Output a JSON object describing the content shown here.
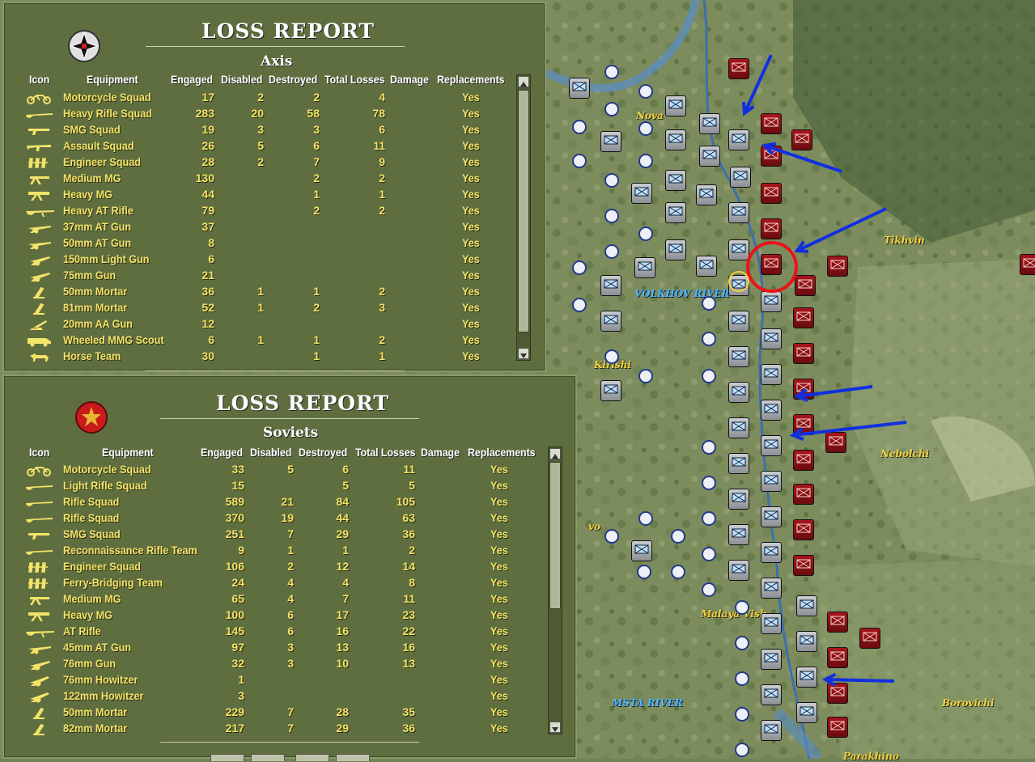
{
  "axis_report": {
    "title": "LOSS REPORT",
    "side": "Axis",
    "columns": [
      "Icon",
      "Equipment",
      "Engaged",
      "Disabled",
      "Destroyed",
      "Total Losses",
      "Damage",
      "Replacements"
    ],
    "rows": [
      {
        "icon": "motorcycle-icon",
        "equipment": "Motorcycle Squad",
        "engaged": "17",
        "disabled": "2",
        "destroyed": "2",
        "total": "4",
        "damage": "",
        "replacements": "Yes"
      },
      {
        "icon": "rifle-icon",
        "equipment": "Heavy Rifle Squad",
        "engaged": "283",
        "disabled": "20",
        "destroyed": "58",
        "total": "78",
        "damage": "",
        "replacements": "Yes"
      },
      {
        "icon": "smg-icon",
        "equipment": "SMG Squad",
        "engaged": "19",
        "disabled": "3",
        "destroyed": "3",
        "total": "6",
        "damage": "",
        "replacements": "Yes"
      },
      {
        "icon": "assault-rifle-icon",
        "equipment": "Assault Squad",
        "engaged": "26",
        "disabled": "5",
        "destroyed": "6",
        "total": "11",
        "damage": "",
        "replacements": "Yes"
      },
      {
        "icon": "engineer-icon",
        "equipment": "Engineer Squad",
        "engaged": "28",
        "disabled": "2",
        "destroyed": "7",
        "total": "9",
        "damage": "",
        "replacements": "Yes"
      },
      {
        "icon": "machine-gun-icon",
        "equipment": "Medium MG",
        "engaged": "130",
        "disabled": "",
        "destroyed": "2",
        "total": "2",
        "damage": "",
        "replacements": "Yes"
      },
      {
        "icon": "heavy-machine-gun-icon",
        "equipment": "Heavy MG",
        "engaged": "44",
        "disabled": "",
        "destroyed": "1",
        "total": "1",
        "damage": "",
        "replacements": "Yes"
      },
      {
        "icon": "at-rifle-icon",
        "equipment": "Heavy AT Rifle",
        "engaged": "79",
        "disabled": "",
        "destroyed": "2",
        "total": "2",
        "damage": "",
        "replacements": "Yes"
      },
      {
        "icon": "at-gun-icon",
        "equipment": "37mm AT Gun",
        "engaged": "37",
        "disabled": "",
        "destroyed": "",
        "total": "",
        "damage": "",
        "replacements": "Yes"
      },
      {
        "icon": "at-gun-icon",
        "equipment": "50mm AT Gun",
        "engaged": "8",
        "disabled": "",
        "destroyed": "",
        "total": "",
        "damage": "",
        "replacements": "Yes"
      },
      {
        "icon": "field-gun-icon",
        "equipment": "150mm Light Gun",
        "engaged": "6",
        "disabled": "",
        "destroyed": "",
        "total": "",
        "damage": "",
        "replacements": "Yes"
      },
      {
        "icon": "field-gun-icon",
        "equipment": "75mm Gun",
        "engaged": "21",
        "disabled": "",
        "destroyed": "",
        "total": "",
        "damage": "",
        "replacements": "Yes"
      },
      {
        "icon": "mortar-icon",
        "equipment": "50mm Mortar",
        "engaged": "36",
        "disabled": "1",
        "destroyed": "1",
        "total": "2",
        "damage": "",
        "replacements": "Yes"
      },
      {
        "icon": "mortar-icon",
        "equipment": "81mm Mortar",
        "engaged": "52",
        "disabled": "1",
        "destroyed": "2",
        "total": "3",
        "damage": "",
        "replacements": "Yes"
      },
      {
        "icon": "aa-gun-icon",
        "equipment": "20mm AA Gun",
        "engaged": "12",
        "disabled": "",
        "destroyed": "",
        "total": "",
        "damage": "",
        "replacements": "Yes"
      },
      {
        "icon": "armored-car-icon",
        "equipment": "Wheeled MMG Scout",
        "engaged": "6",
        "disabled": "1",
        "destroyed": "1",
        "total": "2",
        "damage": "",
        "replacements": "Yes"
      },
      {
        "icon": "horse-icon",
        "equipment": "Horse Team",
        "engaged": "30",
        "disabled": "",
        "destroyed": "1",
        "total": "1",
        "damage": "",
        "replacements": "Yes"
      }
    ],
    "scroll_position": 0.0
  },
  "soviet_report": {
    "title": "LOSS REPORT",
    "side": "Soviets",
    "columns": [
      "Icon",
      "Equipment",
      "Engaged",
      "Disabled",
      "Destroyed",
      "Total Losses",
      "Damage",
      "Replacements"
    ],
    "rows": [
      {
        "icon": "motorcycle-icon",
        "equipment": "Motorcycle Squad",
        "engaged": "33",
        "disabled": "5",
        "destroyed": "6",
        "total": "11",
        "damage": "",
        "replacements": "Yes"
      },
      {
        "icon": "rifle-icon",
        "equipment": "Light Rifle Squad",
        "engaged": "15",
        "disabled": "",
        "destroyed": "5",
        "total": "5",
        "damage": "",
        "replacements": "Yes"
      },
      {
        "icon": "rifle-icon",
        "equipment": "Rifle Squad",
        "engaged": "589",
        "disabled": "21",
        "destroyed": "84",
        "total": "105",
        "damage": "",
        "replacements": "Yes"
      },
      {
        "icon": "rifle-icon",
        "equipment": "Rifle Squad",
        "engaged": "370",
        "disabled": "19",
        "destroyed": "44",
        "total": "63",
        "damage": "",
        "replacements": "Yes"
      },
      {
        "icon": "smg-icon",
        "equipment": "SMG Squad",
        "engaged": "251",
        "disabled": "7",
        "destroyed": "29",
        "total": "36",
        "damage": "",
        "replacements": "Yes"
      },
      {
        "icon": "rifle-icon",
        "equipment": "Reconnaissance Rifle Team",
        "engaged": "9",
        "disabled": "1",
        "destroyed": "1",
        "total": "2",
        "damage": "",
        "replacements": "Yes"
      },
      {
        "icon": "engineer-icon",
        "equipment": "Engineer Squad",
        "engaged": "106",
        "disabled": "2",
        "destroyed": "12",
        "total": "14",
        "damage": "",
        "replacements": "Yes"
      },
      {
        "icon": "engineer-icon",
        "equipment": "Ferry-Bridging Team",
        "engaged": "24",
        "disabled": "4",
        "destroyed": "4",
        "total": "8",
        "damage": "",
        "replacements": "Yes"
      },
      {
        "icon": "machine-gun-icon",
        "equipment": "Medium MG",
        "engaged": "65",
        "disabled": "4",
        "destroyed": "7",
        "total": "11",
        "damage": "",
        "replacements": "Yes"
      },
      {
        "icon": "heavy-machine-gun-icon",
        "equipment": "Heavy MG",
        "engaged": "100",
        "disabled": "6",
        "destroyed": "17",
        "total": "23",
        "damage": "",
        "replacements": "Yes"
      },
      {
        "icon": "at-rifle-icon",
        "equipment": "AT Rifle",
        "engaged": "145",
        "disabled": "6",
        "destroyed": "16",
        "total": "22",
        "damage": "",
        "replacements": "Yes"
      },
      {
        "icon": "at-gun-icon",
        "equipment": "45mm AT Gun",
        "engaged": "97",
        "disabled": "3",
        "destroyed": "13",
        "total": "16",
        "damage": "",
        "replacements": "Yes"
      },
      {
        "icon": "field-gun-icon",
        "equipment": "76mm Gun",
        "engaged": "32",
        "disabled": "3",
        "destroyed": "10",
        "total": "13",
        "damage": "",
        "replacements": "Yes"
      },
      {
        "icon": "howitzer-icon",
        "equipment": "76mm Howitzer",
        "engaged": "1",
        "disabled": "",
        "destroyed": "",
        "total": "",
        "damage": "",
        "replacements": "Yes"
      },
      {
        "icon": "howitzer-icon",
        "equipment": "122mm Howitzer",
        "engaged": "3",
        "disabled": "",
        "destroyed": "",
        "total": "",
        "damage": "",
        "replacements": "Yes"
      },
      {
        "icon": "mortar-icon",
        "equipment": "50mm Mortar",
        "engaged": "229",
        "disabled": "7",
        "destroyed": "28",
        "total": "35",
        "damage": "",
        "replacements": "Yes"
      },
      {
        "icon": "mortar-icon",
        "equipment": "82mm Mortar",
        "engaged": "217",
        "disabled": "7",
        "destroyed": "29",
        "total": "36",
        "damage": "",
        "replacements": "Yes"
      }
    ],
    "scroll_position": 0.0
  },
  "map": {
    "place_labels": [
      {
        "name": "Tikhvin",
        "color": "#f3d23a"
      },
      {
        "name": "Kirishi",
        "color": "#f3d23a"
      },
      {
        "name": "Nebolchi",
        "color": "#f3d23a"
      },
      {
        "name": "Malaya Vish",
        "color": "#f3d23a"
      },
      {
        "name": "Borovichi",
        "color": "#f3d23a"
      },
      {
        "name": "Parakhino",
        "color": "#f3d23a"
      },
      {
        "name": "Nova",
        "color": "#f3d23a"
      },
      {
        "name": "vo",
        "color": "#f3d23a"
      },
      {
        "name": "VOLKHOV RIVER",
        "color": "#4ab8ff"
      },
      {
        "name": "MSTA RIVER",
        "color": "#4ab8ff"
      }
    ],
    "colors": {
      "axis_unit": "#d9dcdf",
      "soviet_unit": "#a8141b",
      "arrow": "#1030e0",
      "highlight": "#e8141b"
    }
  }
}
